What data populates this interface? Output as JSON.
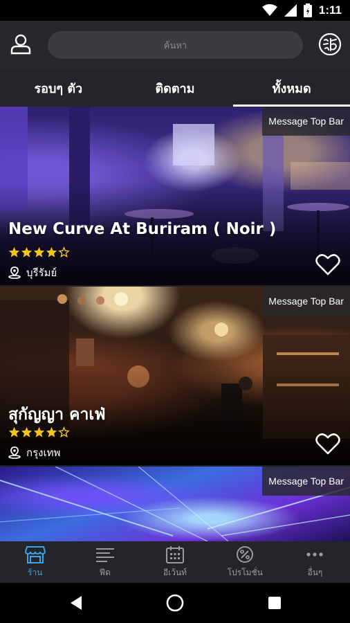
{
  "status_bar": {
    "time": "1:11"
  },
  "header": {
    "search_placeholder": "ค้นหา"
  },
  "tabs": [
    {
      "label": "รอบๆ ตัว",
      "active": false
    },
    {
      "label": "ติดตาม",
      "active": false
    },
    {
      "label": "ทั้งหมด",
      "active": true
    }
  ],
  "cards": [
    {
      "badge": "Message Top Bar",
      "name": "New Curve At Buriram ( Noir )",
      "rating": 4,
      "max_rating": 5,
      "location": "บุรีรัมย์"
    },
    {
      "badge": "Message Top Bar",
      "name": "สุกัญญา คาเฟ่",
      "rating": 4,
      "max_rating": 5,
      "location": "กรุงเทพ"
    },
    {
      "badge": "Message Top Bar"
    }
  ],
  "bottom_nav": [
    {
      "label": "ร้าน",
      "icon": "store-icon",
      "active": true
    },
    {
      "label": "ฟีด",
      "icon": "feed-icon",
      "active": false
    },
    {
      "label": "อีเว้นท์",
      "icon": "calendar-icon",
      "active": false
    },
    {
      "label": "โปรโมชั่น",
      "icon": "percent-icon",
      "active": false
    },
    {
      "label": "อื่นๆ",
      "icon": "more-icon",
      "active": false
    }
  ],
  "colors": {
    "accent": "#36a6e9",
    "star": "#f5c518",
    "background": "#1d1f21"
  }
}
